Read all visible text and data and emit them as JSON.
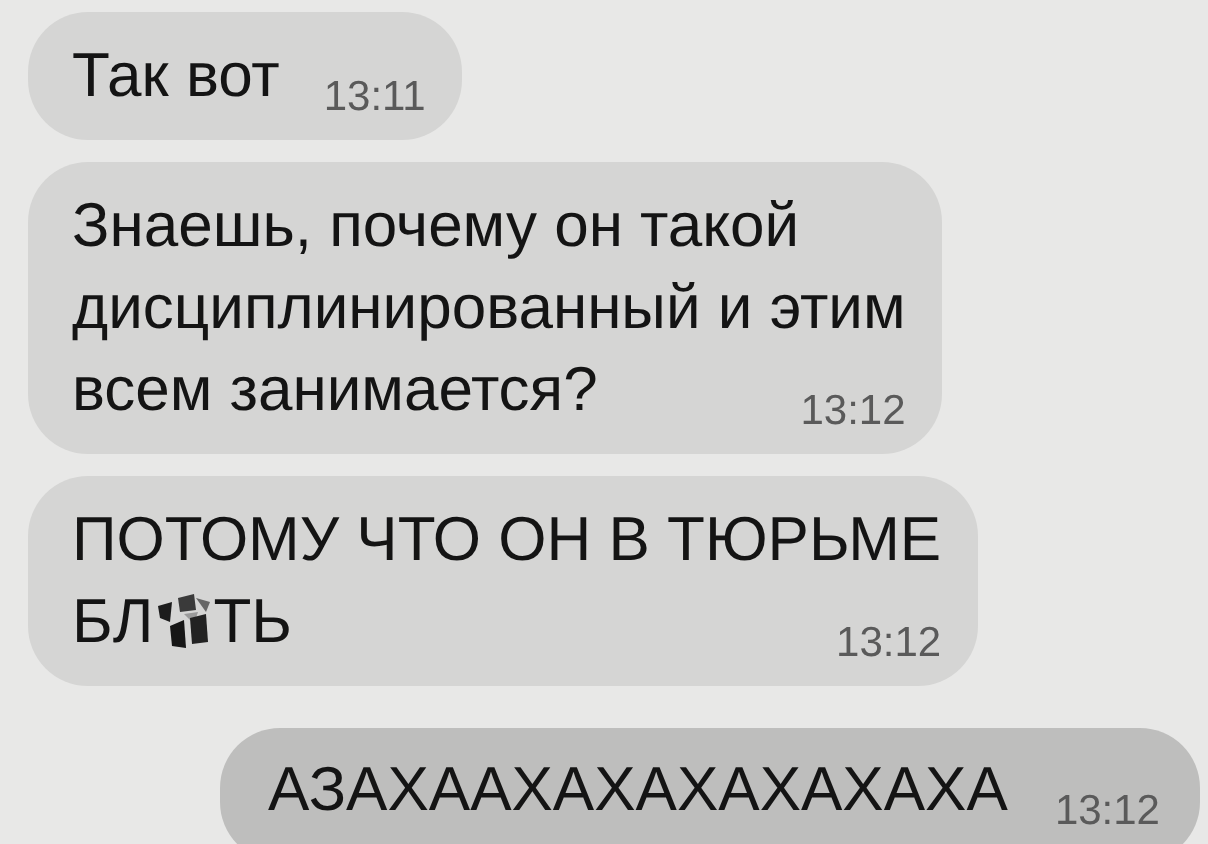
{
  "messages": [
    {
      "kind": "received",
      "lines": [
        [
          {
            "kind": "text",
            "text": "Так вот"
          }
        ]
      ],
      "time": "13:11"
    },
    {
      "kind": "received",
      "lines": [
        [
          {
            "kind": "text",
            "text": "Знаешь, почему он такой"
          }
        ],
        [
          {
            "kind": "text",
            "text": "дисциплинированный и этим"
          }
        ],
        [
          {
            "kind": "text",
            "text": "всем занимается?"
          }
        ]
      ],
      "time": "13:12"
    },
    {
      "kind": "received",
      "lines": [
        [
          {
            "kind": "text",
            "text": "ПОТОМУ ЧТО ОН В ТЮРЬМЕ"
          }
        ],
        [
          {
            "kind": "text",
            "text": "БЛ"
          },
          {
            "kind": "censor"
          },
          {
            "kind": "text",
            "text": "ТЬ"
          }
        ]
      ],
      "time": "13:12"
    },
    {
      "kind": "sent",
      "lines": [
        [
          {
            "kind": "text",
            "text": "АЗАХААХАХАХАХАХАХА"
          }
        ]
      ],
      "time": "13:12"
    }
  ]
}
